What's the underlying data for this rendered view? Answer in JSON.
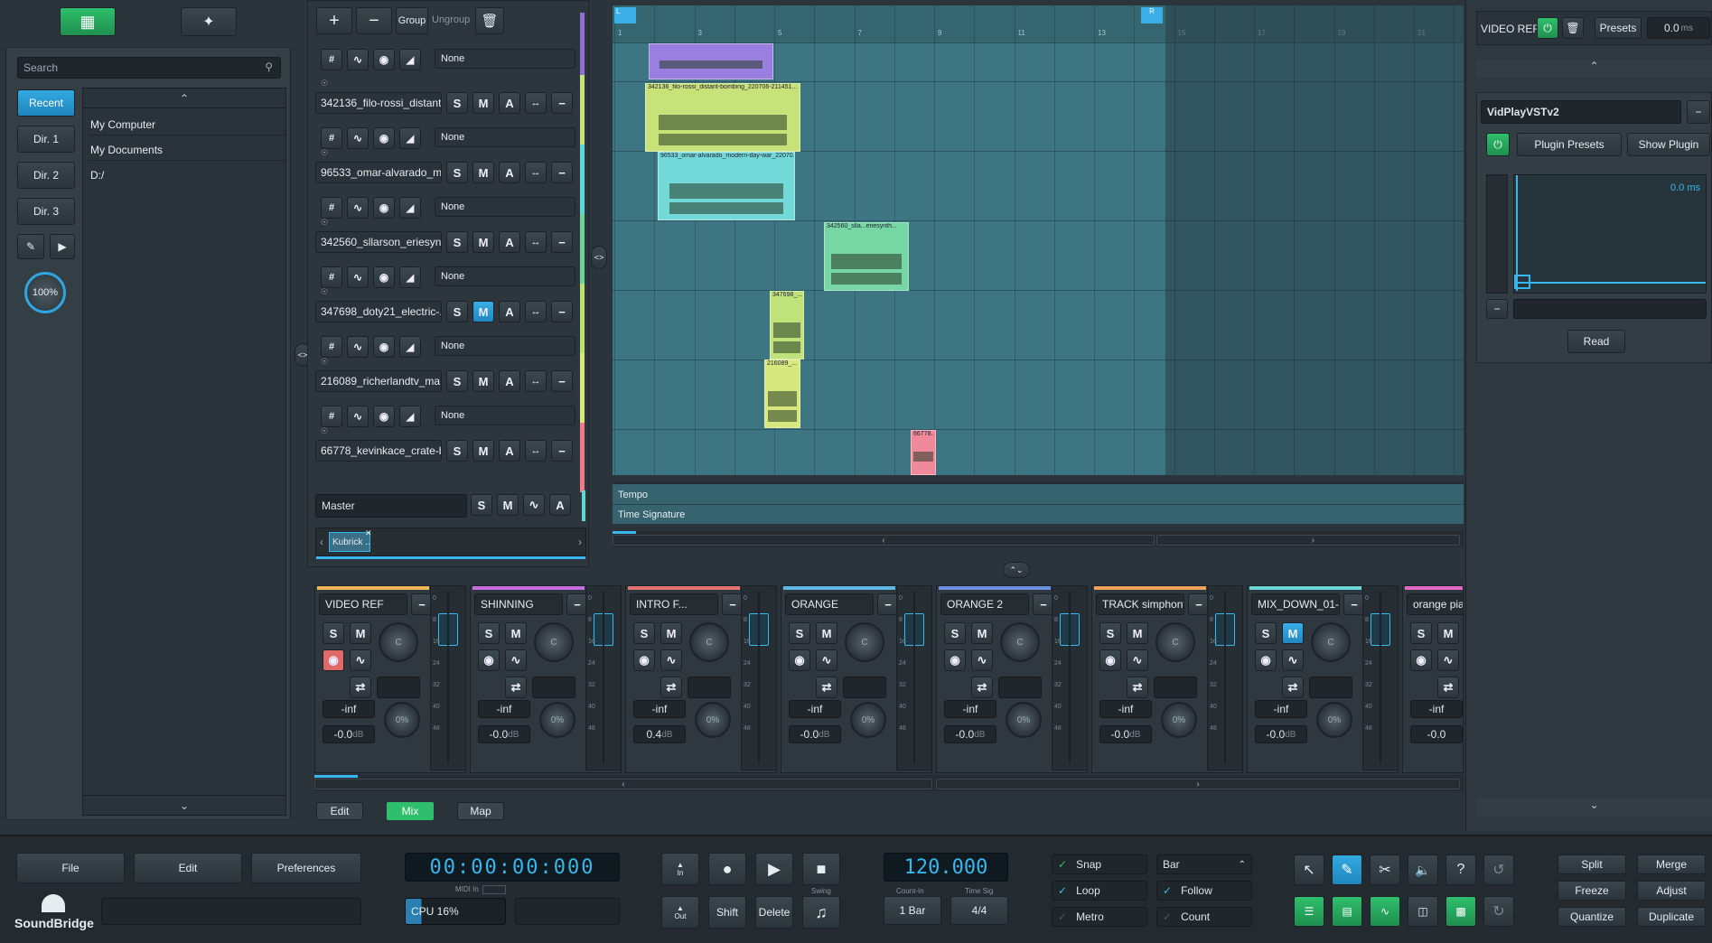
{
  "browser": {
    "search_placeholder": "Search",
    "dirs": [
      "Recent",
      "Dir. 1",
      "Dir. 2",
      "Dir. 3"
    ],
    "zoom": "100%",
    "items": [
      "My Computer",
      "My Documents",
      "D:/"
    ]
  },
  "toolbar": {
    "group": "Group",
    "ungroup": "Ungroup"
  },
  "tracks": [
    {
      "name": "",
      "color": "#8f6fd3",
      "mute": false,
      "none": "None"
    },
    {
      "name": "342136_filo-rossi_distant...",
      "color": "#c8e27a",
      "mute": false,
      "none": "None"
    },
    {
      "name": "96533_omar-alvarado_mo...",
      "color": "#5cd6d6",
      "mute": false,
      "none": "None"
    },
    {
      "name": "342560_sllarson_eriesynth",
      "color": "#6cd49a",
      "mute": false,
      "none": "None"
    },
    {
      "name": "347698_doty21_electric-...",
      "color": "#b9e070",
      "mute": true,
      "none": "None"
    },
    {
      "name": "216089_richerlandtv_ma...",
      "color": "#d8e87a",
      "mute": false,
      "none": "None"
    },
    {
      "name": "66778_kevinkace_crate-b...",
      "color": "#f07a8a",
      "mute": false,
      "none": ""
    }
  ],
  "master": {
    "label": "Master"
  },
  "scene_tab": "Kubrick ...",
  "arrange": {
    "ruler": [
      "1",
      "3",
      "5",
      "7",
      "9",
      "11",
      "13",
      "15",
      "17",
      "19",
      "21"
    ],
    "loop_l": "L",
    "loop_r": "R",
    "tempo": "Tempo",
    "timesig": "Time Signature",
    "clips": [
      {
        "label": "",
        "color": "#9b7fe0"
      },
      {
        "label": "342136_filo-rossi_distant-bombing_220706-211451...",
        "color": "#c8e27a"
      },
      {
        "label": "96533_omar-alvarado_modern-day-war_22070...",
        "color": "#72d8d8"
      },
      {
        "label": "342560_slla...eriesynth...",
        "color": "#76d6a4"
      },
      {
        "label": "347698_...",
        "color": "#bfe27a"
      },
      {
        "label": "216089_...",
        "color": "#d6e87e"
      },
      {
        "label": "66778...",
        "color": "#f08a9a"
      }
    ]
  },
  "mixer": {
    "strips": [
      {
        "name": "VIDEO REF",
        "color": "#f0b65a",
        "vol": "-inf",
        "db": "-0.0",
        "dbunit": "dB"
      },
      {
        "name": "SHINNING",
        "color": "#c56ee0",
        "vol": "-inf",
        "db": "-0.0",
        "dbunit": "dB"
      },
      {
        "name": "INTRO F...",
        "color": "#e57373",
        "vol": "-inf",
        "db": "0.4",
        "dbunit": "dB"
      },
      {
        "name": "ORANGE",
        "color": "#5fb8e6",
        "vol": "-inf",
        "db": "-0.0",
        "dbunit": "dB"
      },
      {
        "name": "ORANGE 2",
        "color": "#6f8fe0",
        "vol": "-inf",
        "db": "-0.0",
        "dbunit": "dB"
      },
      {
        "name": "TRACK simphony",
        "color": "#f0a25a",
        "vol": "-inf",
        "db": "-0.0",
        "dbunit": "dB"
      },
      {
        "name": "MIX_DOWN_01-...",
        "color": "#6cd6d6",
        "vol": "-inf",
        "db": "-0.0",
        "dbunit": "dB"
      },
      {
        "name": "orange piano",
        "color": "#e06ac4",
        "vol": "-inf",
        "db": "-0.0",
        "dbunit": ""
      }
    ],
    "knob_c": "C",
    "knob_pct": "0%",
    "meter_scale": [
      "0",
      "8",
      "16",
      "24",
      "32",
      "40",
      "48"
    ]
  },
  "view_tabs": [
    "Edit",
    "Mix",
    "Map"
  ],
  "plugin": {
    "track": "VIDEO REF",
    "presets": "Presets",
    "value": "0.0",
    "unit": "ms",
    "name": "VidPlayVSTv2",
    "plugin_presets": "Plugin Presets",
    "show_plugin": "Show Plugin",
    "offset": "0.0 ms",
    "read": "Read"
  },
  "bottom": {
    "file": "File",
    "edit": "Edit",
    "preferences": "Preferences",
    "logo": "SoundBridge",
    "time": "00:00:00:000",
    "midi_in": "MIDI In",
    "cpu": "CPU 16%",
    "in": "In",
    "out": "Out",
    "shift": "Shift",
    "delete": "Delete",
    "swing": "Swing",
    "tempo": "120.000",
    "count_in_label": "Count-In",
    "timesig_label": "Time Sig",
    "count_in": "1 Bar",
    "timesig": "4/4",
    "snap": "Snap",
    "loop": "Loop",
    "metro": "Metro",
    "bar": "Bar",
    "follow": "Follow",
    "count": "Count",
    "split": "Split",
    "merge": "Merge",
    "freeze": "Freeze",
    "adjust": "Adjust",
    "quantize": "Quantize",
    "duplicate": "Duplicate"
  }
}
